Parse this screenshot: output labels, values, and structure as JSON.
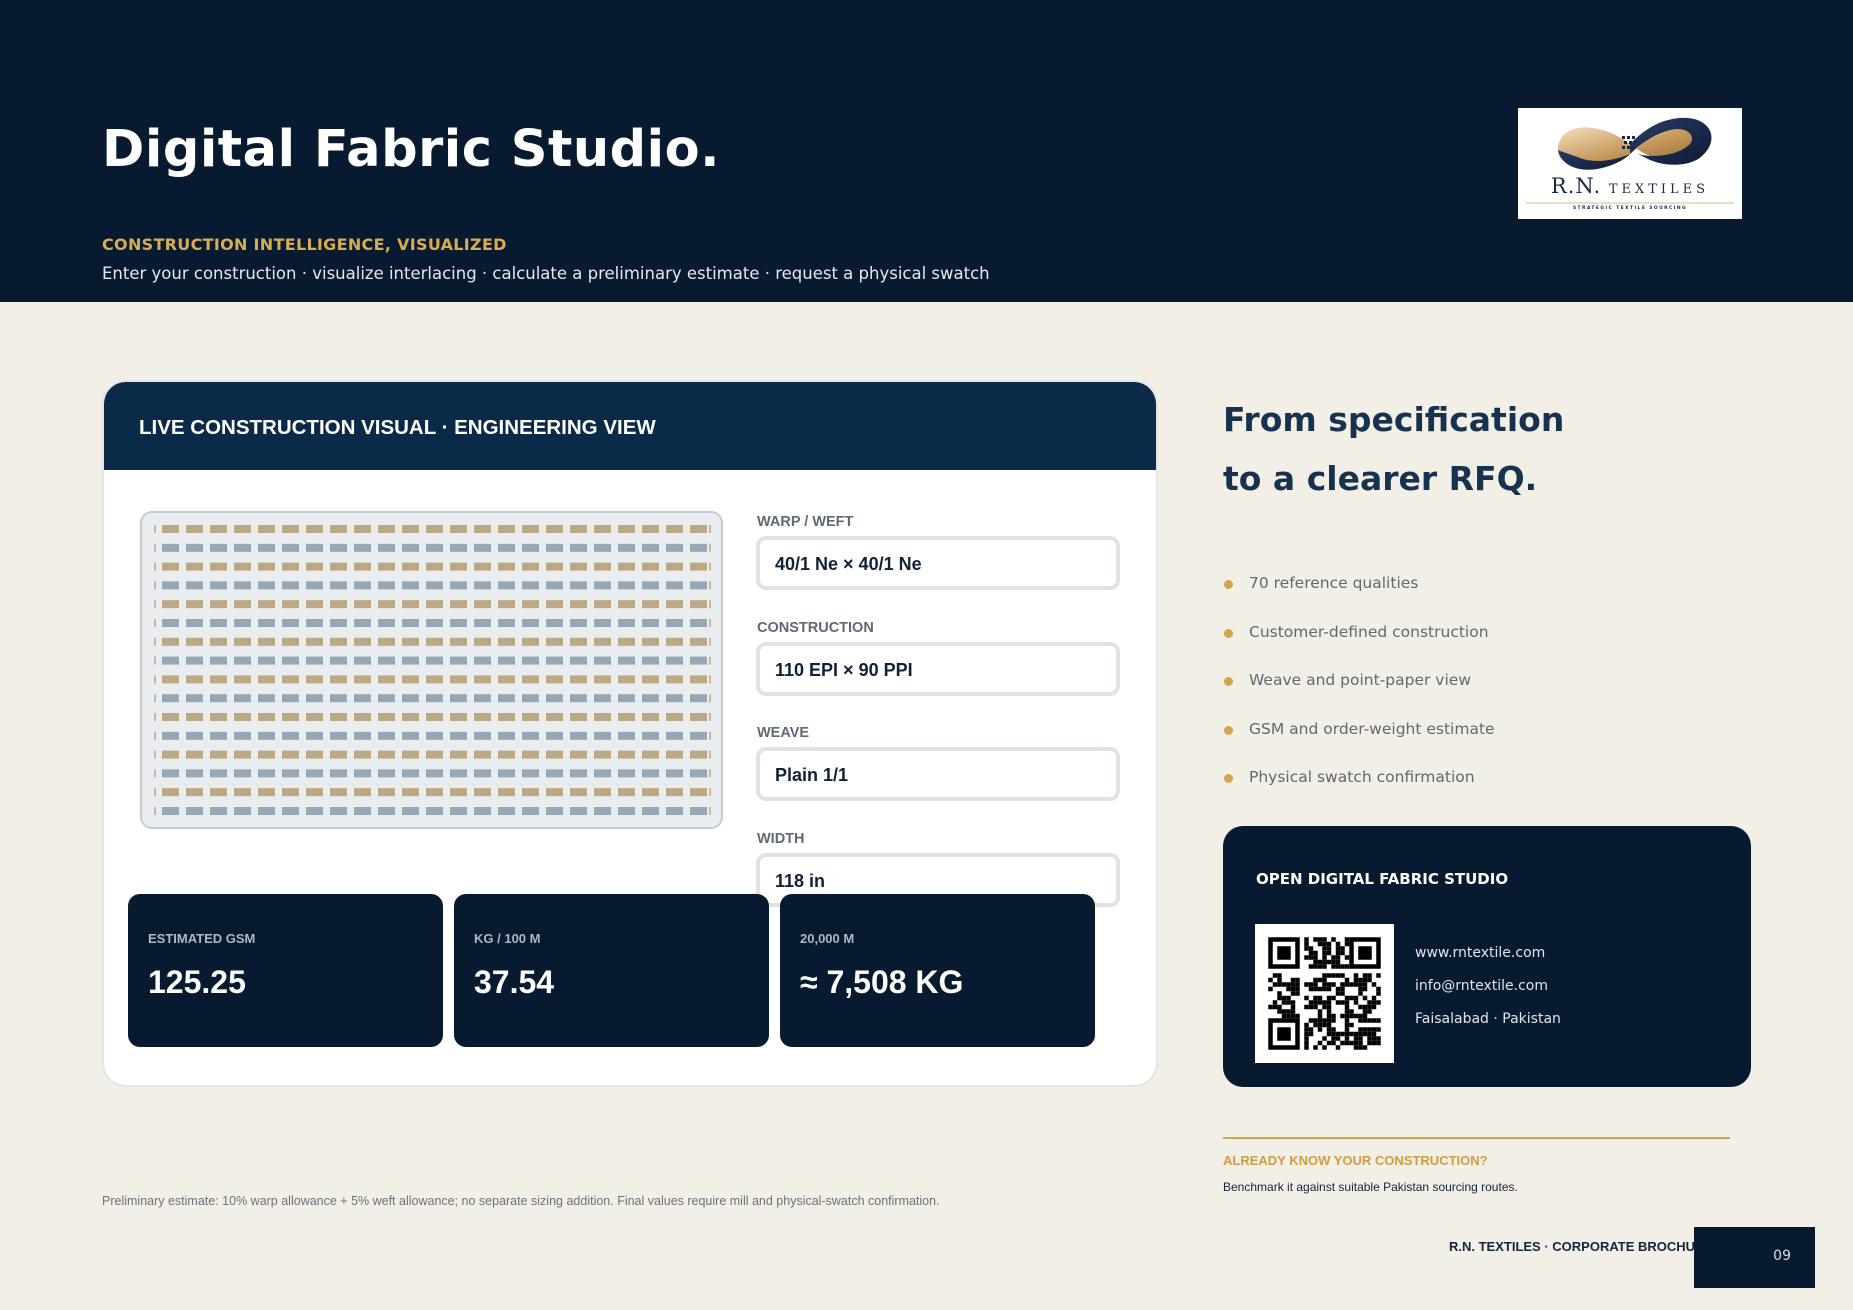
{
  "header": {
    "title": "Digital Fabric Studio.",
    "kicker": "CONSTRUCTION INTELLIGENCE, VISUALIZED",
    "subline": "Enter your construction · visualize interlacing · calculate a preliminary estimate · request a physical swatch"
  },
  "logo": {
    "initials": "R.N.",
    "wordmark": "TEXTILES",
    "tagline": "STRATEGIC TEXTILE SOURCING"
  },
  "card": {
    "title": "LIVE CONSTRUCTION VISUAL · ENGINEERING VIEW",
    "fields": [
      {
        "label": "WARP / WEFT",
        "value": "40/1 Ne × 40/1 Ne"
      },
      {
        "label": "CONSTRUCTION",
        "value": "110 EPI × 90 PPI"
      },
      {
        "label": "WEAVE",
        "value": "Plain 1/1"
      },
      {
        "label": "WIDTH",
        "value": "118 in"
      }
    ],
    "stats": [
      {
        "label": "ESTIMATED GSM",
        "value": "125.25"
      },
      {
        "label": "KG / 100 M",
        "value": "37.54"
      },
      {
        "label": "20,000 M",
        "value": "≈ 7,508 KG"
      }
    ],
    "weave_colors": {
      "warp": "#bca983",
      "weft": "#95a8b6",
      "divider": "#c9b896"
    }
  },
  "footnote": "Preliminary estimate: 10% warp allowance + 5% weft allowance; no separate sizing addition. Final values require mill and physical-swatch confirmation.",
  "right": {
    "heading_line1": "From specification",
    "heading_line2": "to a clearer RFQ.",
    "bullets": [
      "70 reference qualities",
      "Customer-defined construction",
      "Weave and point-paper view",
      "GSM and order-weight estimate",
      "Physical swatch confirmation"
    ],
    "cta": {
      "title": "OPEN DIGITAL FABRIC STUDIO",
      "website": "www.rntextile.com",
      "email": "info@rntextile.com",
      "location": "Faisalabad · Pakistan"
    },
    "already_know": "ALREADY KNOW YOUR CONSTRUCTION?",
    "benchmark": "Benchmark it against suitable Pakistan sourcing routes."
  },
  "footer": {
    "label": "R.N. TEXTILES · CORPORATE BROCHURE",
    "page": "09"
  },
  "colors": {
    "navy": "#071a2f",
    "gold": "#d3a550",
    "background": "#f2efe7"
  }
}
